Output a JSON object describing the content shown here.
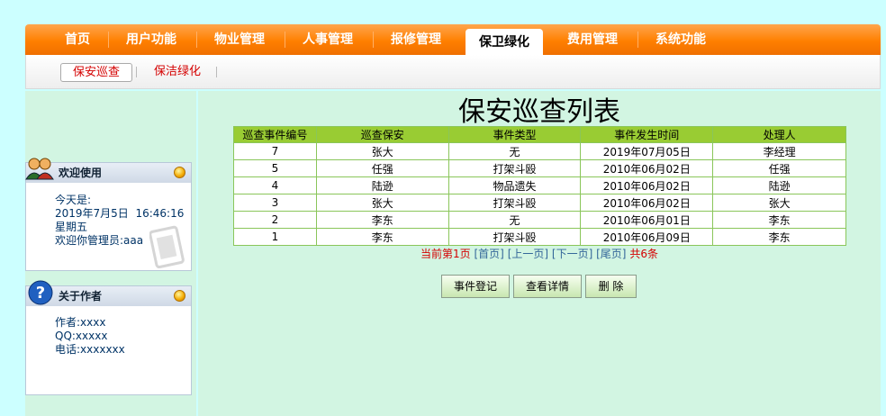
{
  "nav": {
    "items": [
      {
        "label": "首页"
      },
      {
        "label": "用户功能"
      },
      {
        "label": "物业管理"
      },
      {
        "label": "人事管理"
      },
      {
        "label": "报修管理"
      },
      {
        "label": "保卫绿化"
      },
      {
        "label": "费用管理"
      },
      {
        "label": "系统功能"
      }
    ],
    "active": "保卫绿化"
  },
  "subnav": {
    "items": [
      {
        "label": "保安巡查"
      },
      {
        "label": "保洁绿化"
      }
    ],
    "active": "保安巡查"
  },
  "welcome": {
    "title": "欢迎使用",
    "today_label": "今天是:",
    "datetime": "2019年7月5日  16:46:16",
    "weekday": "星期五",
    "greeting": "欢迎你管理员:aaa"
  },
  "author": {
    "title": "关于作者",
    "name": "作者:xxxx",
    "qq": "QQ:xxxxx",
    "phone": "电话:xxxxxxx"
  },
  "page": {
    "title": "保安巡查列表",
    "columns": [
      "巡查事件编号",
      "巡查保安",
      "事件类型",
      "事件发生时间",
      "处理人"
    ],
    "rows": [
      [
        "7",
        "张大",
        "无",
        "2019年07月05日",
        "李经理"
      ],
      [
        "5",
        "任强",
        "打架斗殴",
        "2010年06月02日",
        "任强"
      ],
      [
        "4",
        "陆逊",
        "物品遗失",
        "2010年06月02日",
        "陆逊"
      ],
      [
        "3",
        "张大",
        "打架斗殴",
        "2010年06月02日",
        "张大"
      ],
      [
        "2",
        "李东",
        "无",
        "2010年06月01日",
        "李东"
      ],
      [
        "1",
        "李东",
        "打架斗殴",
        "2010年06月09日",
        "李东"
      ]
    ],
    "pager": {
      "current": "当前第1页",
      "first": "[首页]",
      "prev": "[上一页]",
      "next": "[下一页]",
      "last": "[尾页]",
      "total": "共6条"
    },
    "buttons": {
      "register": "事件登记",
      "detail": "查看详情",
      "delete": "删 除"
    }
  },
  "colors": {
    "nav_orange": "#ff7f00",
    "header_green": "#99cc33",
    "bg_cyan": "#ccffff",
    "pane_green": "#d2f5e2",
    "pager_red": "#d40000",
    "pager_blue": "#336699"
  }
}
